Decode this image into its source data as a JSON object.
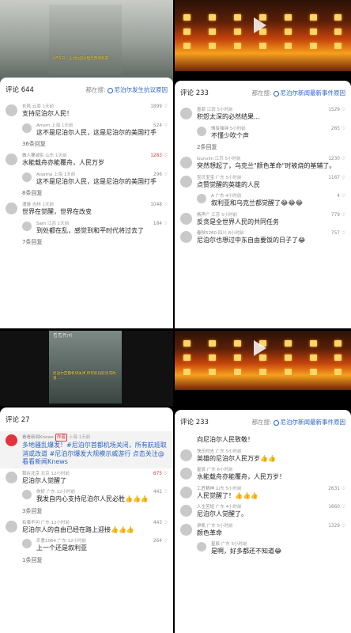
{
  "tl": {
    "video_caption": "8月5日，孟加拉国总理哈西娜辞职……",
    "comment_count": "评论 644",
    "searching": "都在搜:",
    "search_term": "尼泊尔发生抗议原因",
    "comments": [
      {
        "user": "长风",
        "meta": "云南 1天前",
        "likes": "1899",
        "text": "支持尼泊尔人民！"
      },
      {
        "user": "Amsm",
        "meta": "上海 1天前",
        "likes": "524",
        "text": "这不是尼泊尔人民，这是尼泊尔的美国打手",
        "reply": true
      },
      {
        "more": "36条回复"
      },
      {
        "user": "做人要诚实",
        "meta": "山东 1天前",
        "likes": "1283",
        "text": "水能载舟亦能覆舟，人民万岁",
        "hot": true
      },
      {
        "user": "Aisama",
        "meta": "上海 1天前",
        "likes": "296",
        "text": "这不是尼泊尔人民，这是尼泊尔的美国打手",
        "reply": true
      },
      {
        "more": "8条回复"
      },
      {
        "user": "漫游",
        "meta": "吉林 1天前",
        "likes": "1048",
        "text": "世界在觉醒，世界在改变"
      },
      {
        "user": "Sam",
        "meta": "江苏 1天前",
        "likes": "184",
        "text": "到处都在乱，感觉到和平时代将过去了",
        "reply": true
      },
      {
        "more": "7条回复"
      }
    ]
  },
  "tr": {
    "comment_count": "评论 233",
    "searching": "都在搜:",
    "search_term": "尼泊尔新闻最新事件原因",
    "comments": [
      {
        "user": "墨菲",
        "meta": "江西 5小时前",
        "likes": "1529",
        "text": "积怨太深的必然结果..."
      },
      {
        "user": "情有独钟",
        "meta": "5小时前",
        "likes": "265",
        "text": "不懂少吹个声",
        "reply": true
      },
      {
        "more": "2条回复"
      },
      {
        "user": "Gunvlin",
        "meta": "江苏 5小时前",
        "likes": "1230",
        "text": "突然想起了，乌克兰\"颜色革命\"时被烧的基辅了。"
      },
      {
        "user": "宝贝宝宝",
        "meta": "广东 5小时前",
        "likes": "1167",
        "text": "点赞觉醒的英雄的人民"
      },
      {
        "user": "A",
        "meta": "广东 4小时前",
        "likes": "4",
        "text": "叙利亚和乌克兰都觉醒了😂😂😂",
        "reply": true
      },
      {
        "user": "杨声广",
        "meta": "江苏 5小时前",
        "likes": "779",
        "text": "反贪是全世界人民的共同任务"
      },
      {
        "user": "春秋5260",
        "meta": "四川 8小时前",
        "likes": "757",
        "text": "尼泊尔也想过中东自由要饭的日子了😂"
      }
    ]
  },
  "bl": {
    "channel": "看看新闻",
    "video_caption": "尼泊尔首都机场关闭 所有航班取消或改道……",
    "comment_count": "评论 27",
    "news": {
      "user": "看看新闻Knews",
      "tag": "作者",
      "meta": "上海 1天前",
      "text": "多地骚乱爆发！#尼泊尔首都机场关闭，所有航班取消或改道 #尼泊尔爆发大规模示威游行 点击关注@看看新闻Knews"
    },
    "comments": [
      {
        "user": "我在北京",
        "meta": "北京 12小时前",
        "likes": "675",
        "text": "尼泊尔人觉醒了",
        "hot": true
      },
      {
        "user": "你好",
        "meta": "广东 12小时前",
        "likes": "442",
        "text": "我发自内心支持尼泊尔人民必胜👍👍👍",
        "reply": true
      },
      {
        "more": "3条回复"
      },
      {
        "user": "有事不问",
        "meta": "广东 12小时前",
        "likes": "443",
        "text": "尼泊尔人的自由已经在路上迎接👍👍👍"
      },
      {
        "user": "乐意1064",
        "meta": "广东 12小时前",
        "likes": "264",
        "text": "上一个还是叙利亚",
        "reply": true
      },
      {
        "more": "1条回复"
      }
    ]
  },
  "br": {
    "comment_count": "评论 233",
    "searching": "都在搜:",
    "search_term": "尼泊尔新闻最新事件原因",
    "top_text": "向尼泊尔人民致敬！",
    "comments": [
      {
        "user": "快乐时光",
        "meta": "广东 5小时前",
        "likes": "",
        "text": "英雄的尼泊尔人民万岁👍👍"
      },
      {
        "user": "星辰",
        "meta": "广东 6小时前",
        "likes": "",
        "text": "水能载舟亦能覆舟，人民万岁！"
      },
      {
        "user": "工匠精神",
        "meta": "山东 5小时前",
        "likes": "2631",
        "text": "人民觉醒了！👍👍👍"
      },
      {
        "user": "人生苦短",
        "meta": "广东 4小时前",
        "likes": "1660",
        "text": "尼泊尔人觉醒了。"
      },
      {
        "user": "伊凯",
        "meta": "广东 5小时前",
        "likes": "1329",
        "text": "颜色革命"
      },
      {
        "user": "星辰",
        "meta": "广东 5小时前",
        "likes": "",
        "text": "是啊，好多都还不知道😂",
        "reply": true
      }
    ]
  }
}
